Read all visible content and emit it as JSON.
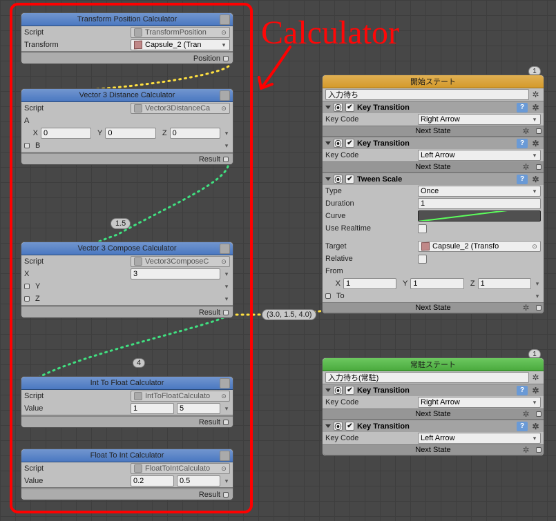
{
  "annotation": {
    "title": "Calculator"
  },
  "edges": {
    "label_1_5": "1.5",
    "label_4": "4",
    "label_vec": "(3.0, 1.5, 4.0)"
  },
  "calc": {
    "transformPos": {
      "title": "Transform Position Calculator",
      "scriptLabel": "Script",
      "scriptValue": "TransformPosition",
      "transformLabel": "Transform",
      "transformValue": "Capsule_2 (Tran",
      "out": "Position"
    },
    "v3dist": {
      "title": "Vector 3 Distance Calculator",
      "scriptLabel": "Script",
      "scriptValue": "Vector3DistanceCa",
      "aLabel": "A",
      "xLabel": "X",
      "xVal": "0",
      "yLabel": "Y",
      "yVal": "0",
      "zLabel": "Z",
      "zVal": "0",
      "bLabel": "B",
      "out": "Result"
    },
    "v3comp": {
      "title": "Vector 3 Compose Calculator",
      "scriptLabel": "Script",
      "scriptValue": "Vector3ComposeC",
      "xLabel": "X",
      "xVal": "3",
      "yLabel": "Y",
      "zLabel": "Z",
      "out": "Result"
    },
    "int2float": {
      "title": "Int To Float Calculator",
      "scriptLabel": "Script",
      "scriptValue": "IntToFloatCalculato",
      "valueLabel": "Value",
      "val1": "1",
      "val2": "5",
      "out": "Result"
    },
    "float2int": {
      "title": "Float To Int Calculator",
      "scriptLabel": "Script",
      "scriptValue": "FloatToIntCalculato",
      "valueLabel": "Value",
      "val1": "0.2",
      "val2": "0.5",
      "out": "Result"
    }
  },
  "states": {
    "start": {
      "badge": "1",
      "title": "開始ステート",
      "input": "入力待ち",
      "kt1": {
        "title": "Key Transition",
        "codeLabel": "Key Code",
        "codeValue": "Right Arrow",
        "next": "Next State"
      },
      "kt2": {
        "title": "Key Transition",
        "codeLabel": "Key Code",
        "codeValue": "Left Arrow",
        "next": "Next State"
      },
      "tween": {
        "title": "Tween Scale",
        "typeLabel": "Type",
        "typeValue": "Once",
        "durLabel": "Duration",
        "durValue": "1",
        "curveLabel": "Curve",
        "rtLabel": "Use Realtime",
        "targetLabel": "Target",
        "targetValue": "Capsule_2 (Transfo",
        "relLabel": "Relative",
        "fromLabel": "From",
        "fxL": "X",
        "fx": "1",
        "fyL": "Y",
        "fy": "1",
        "fzL": "Z",
        "fz": "1",
        "toLabel": "To",
        "next": "Next State"
      }
    },
    "stay": {
      "badge": "1",
      "title": "常駐ステート",
      "input": "入力待ち(常駐)",
      "kt1": {
        "title": "Key Transition",
        "codeLabel": "Key Code",
        "codeValue": "Right Arrow",
        "next": "Next State"
      },
      "kt2": {
        "title": "Key Transition",
        "codeLabel": "Key Code",
        "codeValue": "Left Arrow",
        "next": "Next State"
      }
    }
  }
}
